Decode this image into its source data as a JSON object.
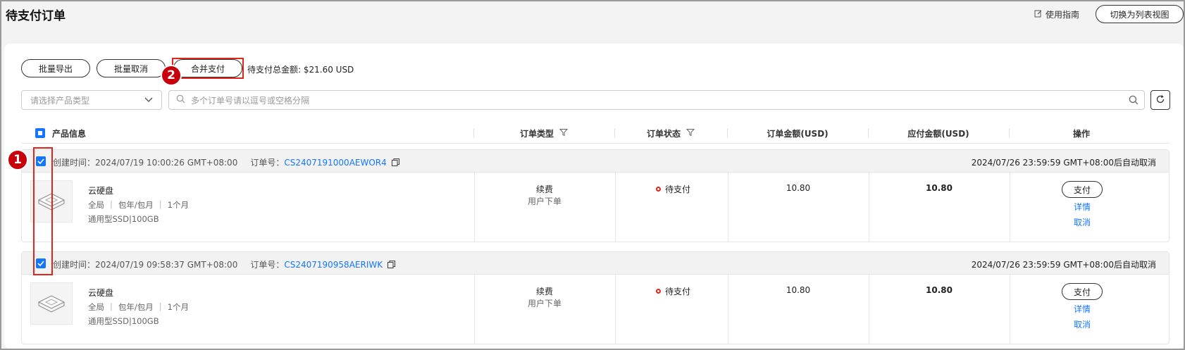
{
  "header": {
    "title": "待支付订单",
    "guide_label": "使用指南",
    "switch_view_label": "切换为列表视图"
  },
  "toolbar": {
    "batch_export": "批量导出",
    "batch_cancel": "批量取消",
    "merge_pay": "合并支付",
    "total_label": "待支付总金额: $21.60 USD"
  },
  "annotations": {
    "step1": "1",
    "step2": "2",
    "highlight_color": "#e0251b",
    "badge_color": "#c7000b"
  },
  "filters": {
    "product_type_placeholder": "请选择产品类型",
    "search_placeholder": "多个订单号请以逗号或空格分隔"
  },
  "table": {
    "columns": [
      "产品信息",
      "订单类型",
      "订单状态",
      "订单金额(USD)",
      "应付金额(USD)",
      "操作"
    ]
  },
  "orders": [
    {
      "created_label": "创建时间：",
      "created_time": "2024/07/19 10:00:26 GMT+08:00",
      "order_no_label": "订单号：",
      "order_no": "CS2407191000AEWOR4",
      "auto_cancel": "2024/07/26 23:59:59 GMT+08:00后自动取消",
      "product_name": "云硬盘",
      "region": "全局",
      "billing": "包年/包月",
      "duration": "1个月",
      "spec": "通用型SSD|100GB",
      "type_main": "续费",
      "type_sub": "用户下单",
      "status": "待支付",
      "order_amount": "10.80",
      "payable_amount": "10.80",
      "pay_label": "支付",
      "detail_label": "详情",
      "cancel_label": "取消"
    },
    {
      "created_label": "创建时间：",
      "created_time": "2024/07/19 09:58:37 GMT+08:00",
      "order_no_label": "订单号：",
      "order_no": "CS2407190958AERIWK",
      "auto_cancel": "2024/07/26 23:59:59 GMT+08:00后自动取消",
      "product_name": "云硬盘",
      "region": "全局",
      "billing": "包年/包月",
      "duration": "1个月",
      "spec": "通用型SSD|100GB",
      "type_main": "续费",
      "type_sub": "用户下单",
      "status": "待支付",
      "order_amount": "10.80",
      "payable_amount": "10.80",
      "pay_label": "支付",
      "detail_label": "详情",
      "cancel_label": "取消"
    }
  ],
  "colors": {
    "primary": "#1476ff",
    "status_pending": "#e0251b"
  }
}
